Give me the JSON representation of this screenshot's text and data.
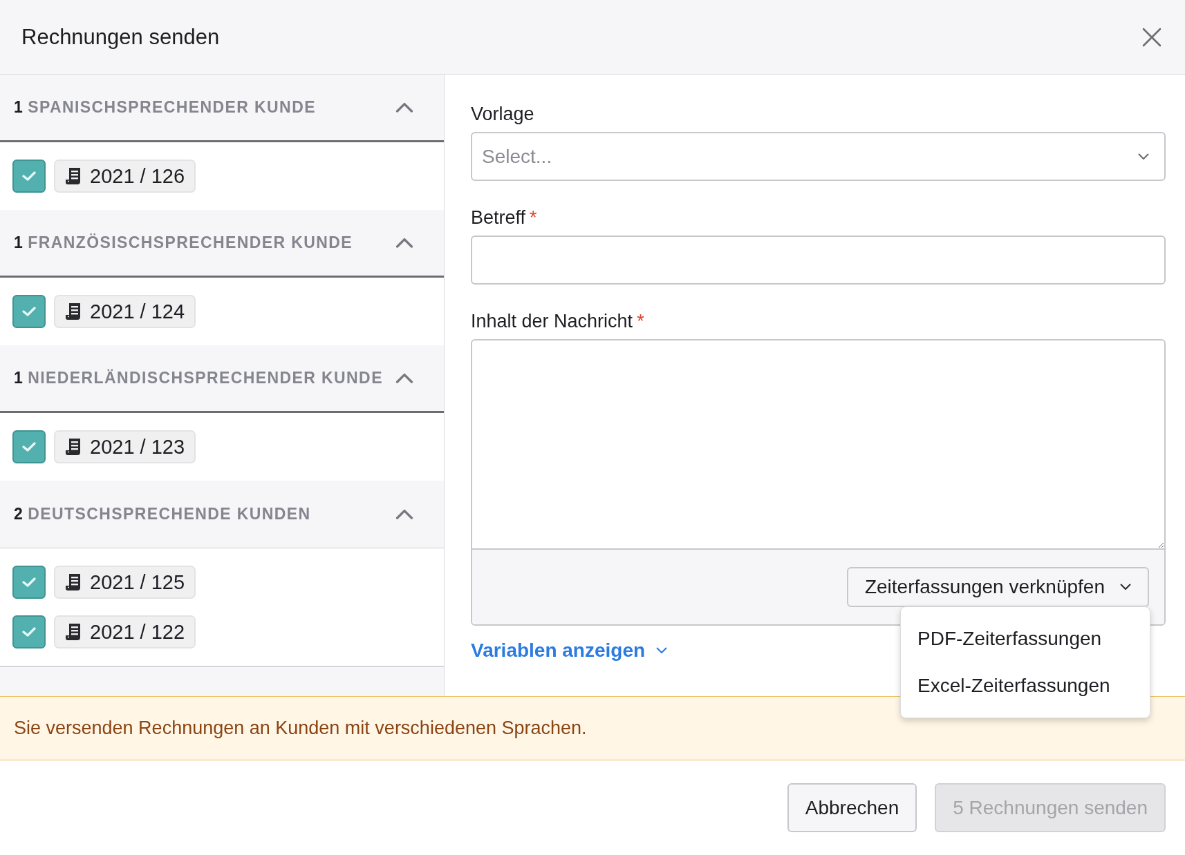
{
  "dialog": {
    "title": "Rechnungen senden"
  },
  "groups": [
    {
      "count": "1",
      "label": "SPANISCHSPRECHENDER KUNDE",
      "expanded": true,
      "invoices": [
        {
          "number": "2021 / 126",
          "checked": true
        }
      ]
    },
    {
      "count": "1",
      "label": "FRANZÖSISCHSPRECHENDER KUNDE",
      "expanded": true,
      "invoices": [
        {
          "number": "2021 / 124",
          "checked": true
        }
      ]
    },
    {
      "count": "1",
      "label": "NIEDERLÄNDISCHSPRECHENDER KUNDE",
      "expanded": true,
      "invoices": [
        {
          "number": "2021 / 123",
          "checked": true
        }
      ]
    },
    {
      "count": "2",
      "label": "DEUTSCHSPRECHENDE KUNDEN",
      "expanded": true,
      "invoices": [
        {
          "number": "2021 / 125",
          "checked": true
        },
        {
          "number": "2021 / 122",
          "checked": true
        }
      ]
    }
  ],
  "form": {
    "template": {
      "label": "Vorlage",
      "placeholder": "Select..."
    },
    "subject": {
      "label": "Betreff",
      "required_mark": "*"
    },
    "message": {
      "label": "Inhalt der Nachricht",
      "required_mark": "*"
    },
    "link_time_button": {
      "label": "Zeiterfassungen verknüpfen",
      "open": true,
      "menu": [
        "PDF-Zeiterfassungen",
        "Excel-Zeiterfassungen"
      ]
    },
    "variables_link": {
      "label": "Variablen anzeigen",
      "expanded": false
    }
  },
  "warning": "Sie versenden Rechnungen an Kunden mit verschiedenen Sprachen.",
  "buttons": [
    {
      "label": "Abbrechen",
      "disabled": false
    },
    {
      "label": "5 Rechnungen senden",
      "disabled": true
    }
  ]
}
